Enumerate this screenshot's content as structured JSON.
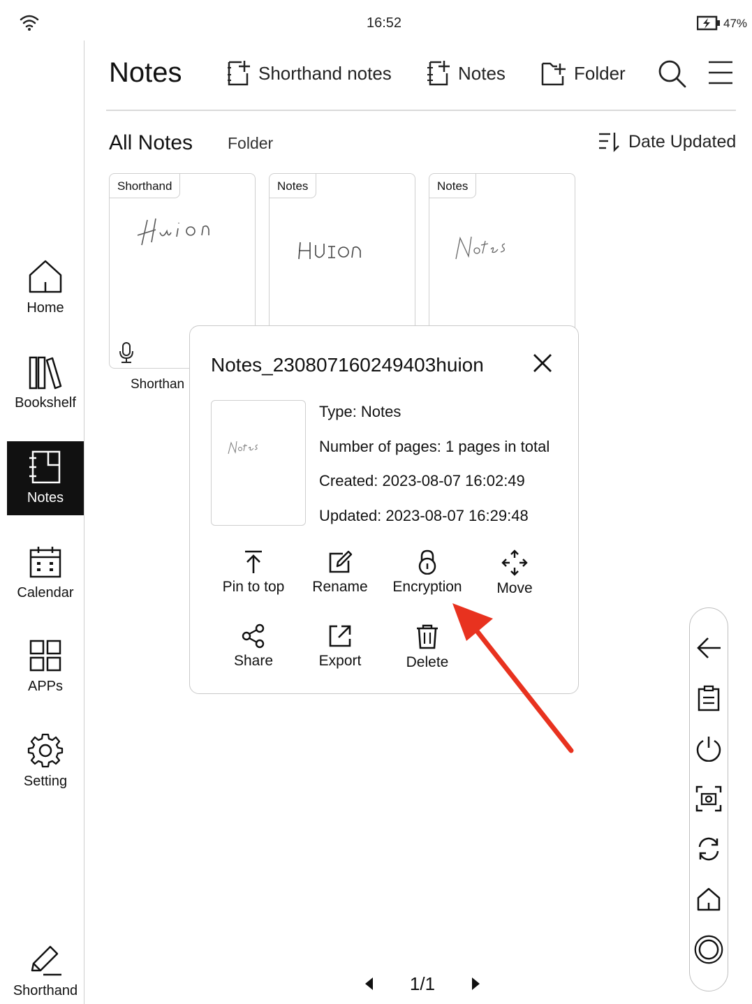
{
  "status_bar": {
    "time": "16:52",
    "battery": "47%"
  },
  "sidebar": {
    "items": [
      {
        "label": "Home",
        "icon": "home-icon"
      },
      {
        "label": "Bookshelf",
        "icon": "bookshelf-icon"
      },
      {
        "label": "Notes",
        "icon": "notes-icon",
        "active": true
      },
      {
        "label": "Calendar",
        "icon": "calendar-icon"
      },
      {
        "label": "APPs",
        "icon": "apps-icon"
      },
      {
        "label": "Setting",
        "icon": "gear-icon"
      },
      {
        "label": "Shorthand",
        "icon": "pen-icon"
      }
    ]
  },
  "header": {
    "title": "Notes",
    "actions": [
      {
        "label": "Shorthand notes",
        "icon": "new-shorthand-icon"
      },
      {
        "label": "Notes",
        "icon": "new-notes-icon"
      },
      {
        "label": "Folder",
        "icon": "new-folder-icon"
      }
    ],
    "search_icon": "search-icon",
    "menu_icon": "menu-icon"
  },
  "filter": {
    "all_notes": "All Notes",
    "folder": "Folder",
    "sort": "Date Updated"
  },
  "cards": [
    {
      "tag": "Shorthand",
      "handwriting": "Huion",
      "caption": "Shorthan"
    },
    {
      "tag": "Notes",
      "handwriting": "HUION"
    },
    {
      "tag": "Notes",
      "handwriting": "Notes"
    }
  ],
  "dialog": {
    "title": "Notes_230807160249403huion",
    "type": "Type: Notes",
    "pages": "Number of pages: 1 pages in total",
    "created": "Created: 2023-08-07 16:02:49",
    "updated": "Updated: 2023-08-07 16:29:48",
    "actions": [
      {
        "label": "Pin to top",
        "icon": "pin-top-icon"
      },
      {
        "label": "Rename",
        "icon": "rename-icon"
      },
      {
        "label": "Encryption",
        "icon": "lock-icon"
      },
      {
        "label": "Move",
        "icon": "move-icon"
      },
      {
        "label": "Share",
        "icon": "share-icon"
      },
      {
        "label": "Export",
        "icon": "export-icon"
      },
      {
        "label": "Delete",
        "icon": "trash-icon"
      }
    ]
  },
  "floating_bar": [
    "back-arrow-icon",
    "clipboard-icon",
    "power-icon",
    "screenshot-icon",
    "refresh-icon",
    "home-icon",
    "circle-button-icon"
  ],
  "pagination": {
    "current": "1/1"
  },
  "colors": {
    "annotation_arrow": "#e8321f",
    "active_nav_bg": "#111111"
  }
}
